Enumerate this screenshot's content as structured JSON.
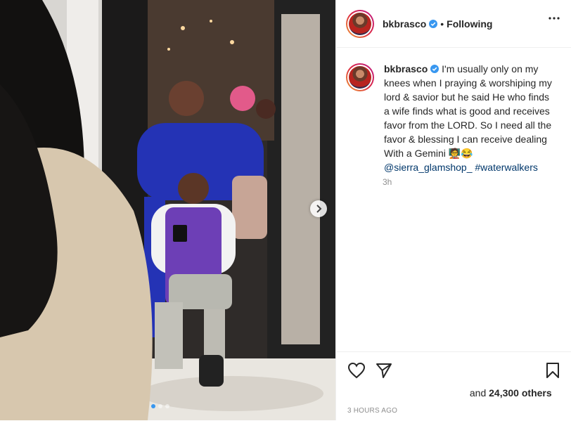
{
  "post": {
    "username": "bkbrasco",
    "separator": "•",
    "follow_state": "Following",
    "caption_username": "bkbrasco",
    "caption_text": "I'm usually only on my knees when I praying & worshiping my lord & savior but he said He who finds a wife finds what is good and receives favor from the LORD. So I need all the favor & blessing I can receive dealing With a Gemini 🧑‍🏫😂",
    "mention": "@sierra_glamshop_",
    "hashtag": "#waterwalkers",
    "relative_time": "3h",
    "likes_suffix": "and",
    "likes_count": "24,300 others",
    "posted_time": "3 HOURS AGO"
  },
  "carousel": {
    "total": 3,
    "active": 1
  },
  "colors": {
    "verified": "#3897f0",
    "link": "#00376b",
    "muted": "#8e8e8e"
  },
  "icons": [
    "more-options-icon",
    "verified-badge-icon",
    "heart-icon",
    "share-icon",
    "bookmark-icon",
    "chevron-right-icon"
  ]
}
